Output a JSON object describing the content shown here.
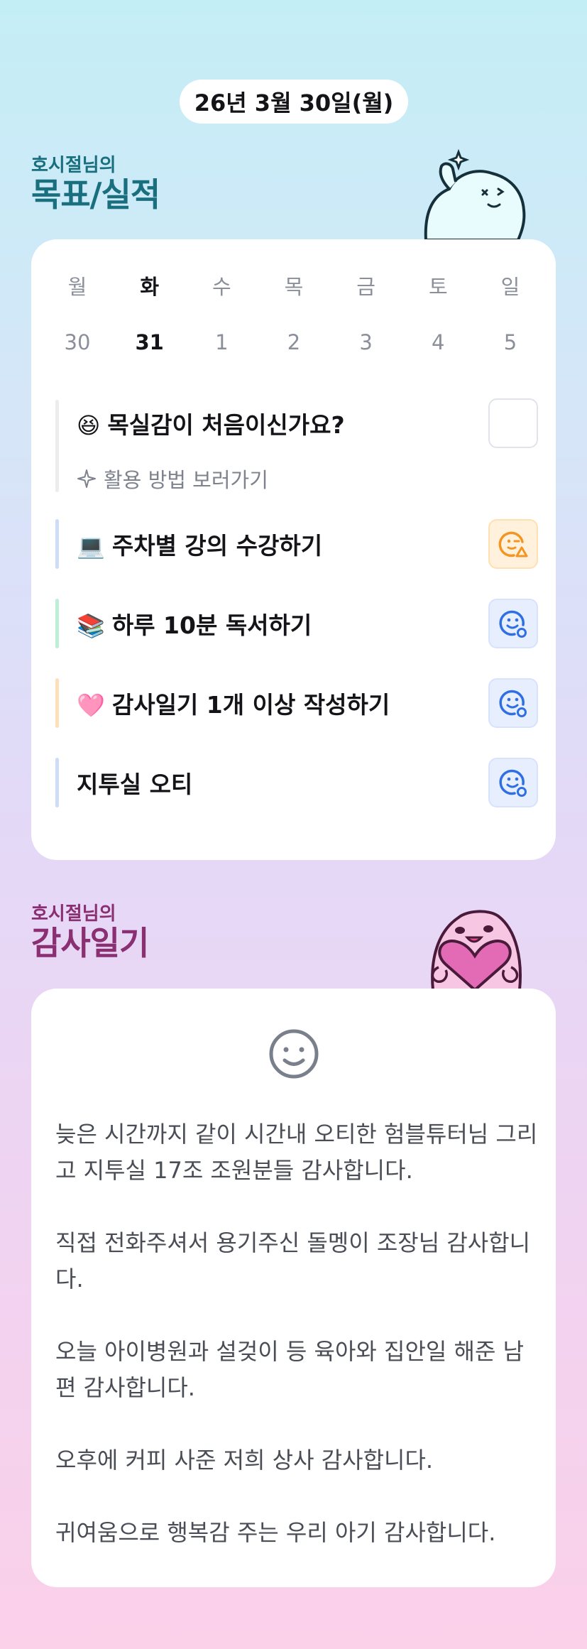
{
  "date": "26년 3월 30일(월)",
  "goals_section": {
    "owner": "호시절님의",
    "title": "목표/실적"
  },
  "week": {
    "days": [
      "월",
      "화",
      "수",
      "목",
      "금",
      "토",
      "일"
    ],
    "dates": [
      "30",
      "31",
      "1",
      "2",
      "3",
      "4",
      "5"
    ],
    "selected_index": 1
  },
  "intro": {
    "emoji": "😆",
    "label": "목실감이 처음이신가요?",
    "guide_label": "활용 방법 보러가기",
    "guide_icon": "sparkle-icon"
  },
  "goals": [
    {
      "emoji": "💻",
      "label": "주차별 강의 수강하기",
      "bar_color": "#cfdcf7",
      "status": "orange",
      "status_icon": "smile-warning-icon"
    },
    {
      "emoji": "📚",
      "label": "하루 10분 독서하기",
      "bar_color": "#bdeed6",
      "status": "blue",
      "status_icon": "smile-check-icon"
    },
    {
      "emoji": "🩷",
      "label": "감사일기 1개 이상 작성하기",
      "bar_color": "#fde0b9",
      "status": "blue",
      "status_icon": "smile-check-icon"
    },
    {
      "emoji": "",
      "label": "지투실 오티",
      "bar_color": "#cfdcf7",
      "status": "blue",
      "status_icon": "smile-check-icon"
    }
  ],
  "thanks_section": {
    "owner": "호시절님의",
    "title": "감사일기"
  },
  "diary": {
    "mood_icon": "smile-face-icon",
    "entries": [
      "늦은 시간까지 같이 시간내 오티한 험블튜터님 그리고 지투실 17조 조원분들 감사합니다.",
      "직접 전화주셔서 용기주신 돌멩이 조장님 감사합니다.",
      "오늘 아이병원과 설겆이 등 육아와 집안일 해준 남편 감사합니다.",
      "오후에 커피 사준 저희 상사 감사합니다.",
      "귀여움으로 행복감 주는 우리 아기 감사합니다."
    ]
  },
  "colors": {
    "goals_accent": "#1a6f7f",
    "thanks_accent": "#8b2f73",
    "blue_status": "#2f6fe4",
    "orange_status": "#f29522"
  }
}
